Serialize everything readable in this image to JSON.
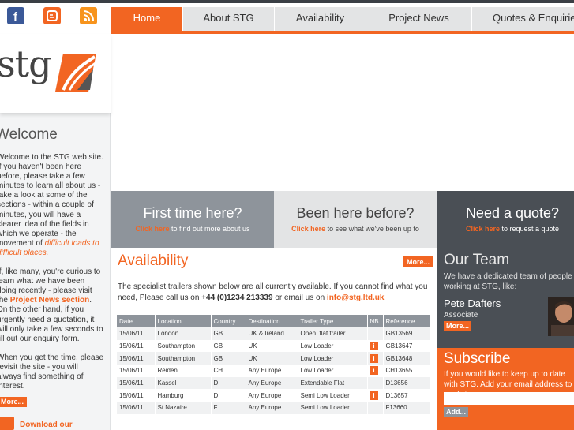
{
  "nav": {
    "items": [
      {
        "label": "Home",
        "active": true
      },
      {
        "label": "About STG"
      },
      {
        "label": "Availability"
      },
      {
        "label": "Project News"
      },
      {
        "label": "Quotes & Enquiries"
      }
    ]
  },
  "social": [
    "facebook-icon",
    "blogger-icon",
    "rss-icon"
  ],
  "colors": {
    "accent": "#f26522",
    "dark": "#4a4f55",
    "grey": "#8e949b"
  },
  "logo": {
    "text": "stg"
  },
  "welcome": {
    "title": "Welcome",
    "p1a": "Welcome to the STG web site. If you haven't been here before, please take a few minutes to learn all about us - take a look at some of the sections - within a couple of minutes, you will have a clearer idea of the fields in which we operate - the movement of ",
    "p1b": "difficult loads to difficult places.",
    "p2a": "If, like many, you're curious to learn what we have been doing recently - please visit the ",
    "p2b": "Project News section",
    "p2c": ". On the other hand, if you urgently need a quotation, it will only take a few seconds to fill out our enquiry form.",
    "p3": "When you get the time, please revisit the site - you will always find something of interest.",
    "more": "More...",
    "download": "Download our"
  },
  "promos": [
    {
      "title": "First time here?",
      "link": "Click here",
      "text": " to find out more about us"
    },
    {
      "title": "Been here before?",
      "link": "Click here",
      "text": " to see what we've been up to"
    },
    {
      "title": "Need a quote?",
      "link": "Click here",
      "text": " to request a quote"
    }
  ],
  "availability": {
    "title": "Availability",
    "more": "More...",
    "intro_a": "The specialist trailers shown below are all currently available. If you cannot find what you need, Please call us on ",
    "phone": "+44 (0)1234 213339",
    "intro_b": " or email us on ",
    "email": "info@stg.ltd.uk",
    "columns": [
      "Date",
      "Location",
      "Country",
      "Destination",
      "Trailer Type",
      "NB",
      "Reference"
    ],
    "rows": [
      {
        "date": "15/06/11",
        "location": "London",
        "country": "GB",
        "destination": "UK & Ireland",
        "type": "Open. flat trailer",
        "nb": "",
        "ref": "GB13569"
      },
      {
        "date": "15/06/11",
        "location": "Southampton",
        "country": "GB",
        "destination": "UK",
        "type": "Low Loader",
        "nb": "i",
        "ref": "GB13647"
      },
      {
        "date": "15/06/11",
        "location": "Southampton",
        "country": "GB",
        "destination": "UK",
        "type": "Low Loader",
        "nb": "i",
        "ref": "GB13648"
      },
      {
        "date": "15/06/11",
        "location": "Reiden",
        "country": "CH",
        "destination": "Any Europe",
        "type": "Low Loader",
        "nb": "i",
        "ref": "CH13655"
      },
      {
        "date": "15/06/11",
        "location": "Kassel",
        "country": "D",
        "destination": "Any Europe",
        "type": "Extendable Flat",
        "nb": "",
        "ref": "D13656"
      },
      {
        "date": "15/06/11",
        "location": "Hamburg",
        "country": "D",
        "destination": "Any Europe",
        "type": "Semi Low Loader",
        "nb": "i",
        "ref": "D13657"
      },
      {
        "date": "15/06/11",
        "location": "St Nazaire",
        "country": "F",
        "destination": "Any Europe",
        "type": "Semi Low Loader",
        "nb": "",
        "ref": "F13660"
      }
    ]
  },
  "team": {
    "title": "Our Team",
    "text": "We have a dedicated team of people working at STG, like:",
    "name": "Pete Dafters",
    "role": "Associate",
    "more": "More..."
  },
  "subscribe": {
    "title": "Subscribe",
    "text": "If you would like to keep up to date with STG. Add your email address to our list",
    "placeholder": "",
    "add": "Add..."
  }
}
